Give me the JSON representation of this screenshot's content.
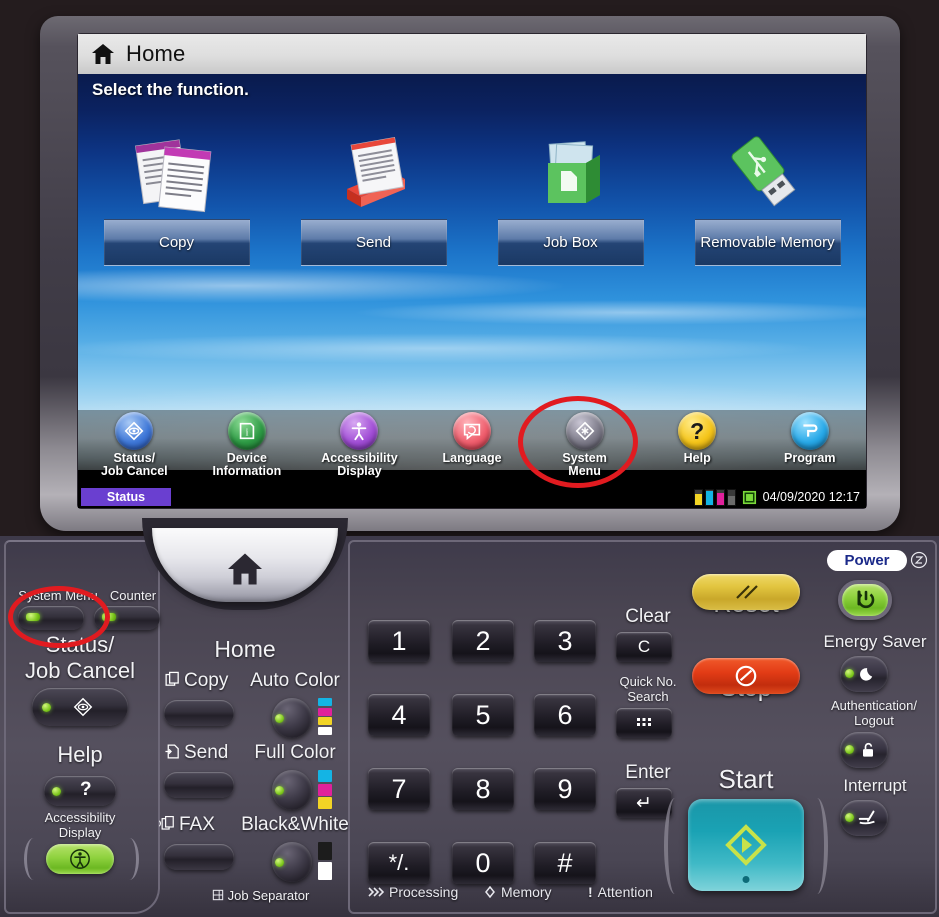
{
  "touchscreen": {
    "title_bar": {
      "title": "Home",
      "icon": "home-icon"
    },
    "prompt": "Select the function.",
    "functions": [
      {
        "label": "Copy",
        "icon": "copy-documents-icon"
      },
      {
        "label": "Send",
        "icon": "send-tray-icon"
      },
      {
        "label": "Job Box",
        "icon": "job-box-icon"
      },
      {
        "label": "Removable Memory",
        "icon": "usb-drive-icon"
      }
    ],
    "shortcuts": [
      {
        "label_line1": "Status/",
        "label_line2": "Job Cancel",
        "icon": "status-job-cancel-icon",
        "color": "#3f78d8"
      },
      {
        "label_line1": "Device",
        "label_line2": "Information",
        "icon": "device-information-icon",
        "color": "#2e9b45"
      },
      {
        "label_line1": "Accessibility",
        "label_line2": "Display",
        "icon": "accessibility-display-icon",
        "color": "#a24fd6"
      },
      {
        "label_line1": "Language",
        "label_line2": "",
        "icon": "language-icon",
        "color": "#ef5f6e"
      },
      {
        "label_line1": "System",
        "label_line2": "Menu",
        "icon": "system-menu-icon",
        "color": "#7c7a88"
      },
      {
        "label_line1": "Help",
        "label_line2": "",
        "icon": "help-icon",
        "color": "#f5c51a"
      },
      {
        "label_line1": "Program",
        "label_line2": "",
        "icon": "program-icon",
        "color": "#28a9e8"
      }
    ],
    "status_bar": {
      "status_label": "Status",
      "datetime": "04/09/2020 12:17",
      "toner_colors": [
        "#f2d425",
        "#14b4e4",
        "#e0219b",
        "#1c1c1c"
      ],
      "paper_icon": "cassette-icon"
    }
  },
  "annotations": {
    "accent_color": "#e11b20",
    "targets": [
      "system-menu-touch-icon",
      "system-menu-hard-key"
    ]
  },
  "operation_panel": {
    "top_keys": [
      {
        "label": "System Menu",
        "name": "system-menu-key"
      },
      {
        "label": "Counter",
        "name": "counter-key"
      }
    ],
    "home_key": {
      "label": "Home",
      "icon": "home-icon"
    },
    "left_column": [
      {
        "label_line1": "Status/",
        "label_line2": "Job Cancel",
        "icon": "status-job-cancel-icon"
      },
      {
        "label_line1": "Help",
        "label_line2": "",
        "icon": "question-mark-icon"
      },
      {
        "label_line1": "Accessibility",
        "label_line2": "Display",
        "icon": "accessibility-icon"
      }
    ],
    "mode_keys": [
      {
        "label": "Copy",
        "icon": "copy-icon"
      },
      {
        "label": "Send",
        "icon": "send-icon"
      },
      {
        "label": "FAX",
        "icon": "fax-icon"
      }
    ],
    "color_keys": [
      {
        "label": "Auto Color",
        "swatch": [
          "#14b4e4",
          "#e0219b",
          "#f2d425",
          "#ffffff"
        ]
      },
      {
        "label": "Full Color",
        "swatch": [
          "#14b4e4",
          "#e0219b",
          "#f2d425"
        ]
      },
      {
        "label": "Black&White",
        "swatch": [
          "#1c1c1c",
          "#ffffff"
        ]
      }
    ],
    "job_separator": {
      "label": "Job Separator",
      "icon": "job-separator-icon"
    },
    "keypad": [
      "1",
      "2",
      "3",
      "4",
      "5",
      "6",
      "7",
      "8",
      "9",
      "*/.",
      "0",
      "#"
    ],
    "edit_keys": [
      {
        "label": "Clear",
        "glyph": "C",
        "name": "clear-key"
      },
      {
        "label_line1": "Quick No.",
        "label_line2": "Search",
        "glyph": "grid-icon",
        "name": "quick-no-search-key"
      },
      {
        "label": "Enter",
        "glyph": "↵",
        "name": "enter-key"
      }
    ],
    "action_keys": [
      {
        "label": "Reset",
        "name": "reset-key",
        "color": "#e2c53f"
      },
      {
        "label": "Stop",
        "name": "stop-key",
        "color": "#e23c16"
      },
      {
        "label": "Start",
        "name": "start-key",
        "color": "#1aa2b4"
      }
    ],
    "power_column": {
      "power_label": "Power",
      "power_glyph": "I/⏻",
      "items": [
        {
          "label": "Energy Saver",
          "icon": "moon-icon"
        },
        {
          "label_line1": "Authentication/",
          "label_line2": "Logout",
          "icon": "lock-icon"
        },
        {
          "label": "Interrupt",
          "icon": "interrupt-icon"
        }
      ]
    },
    "indicators": [
      {
        "label": "Processing",
        "icon": "chevrons-icon"
      },
      {
        "label": "Memory",
        "icon": "diamond-icon"
      },
      {
        "label": "Attention",
        "icon": "exclamation-icon"
      }
    ]
  }
}
